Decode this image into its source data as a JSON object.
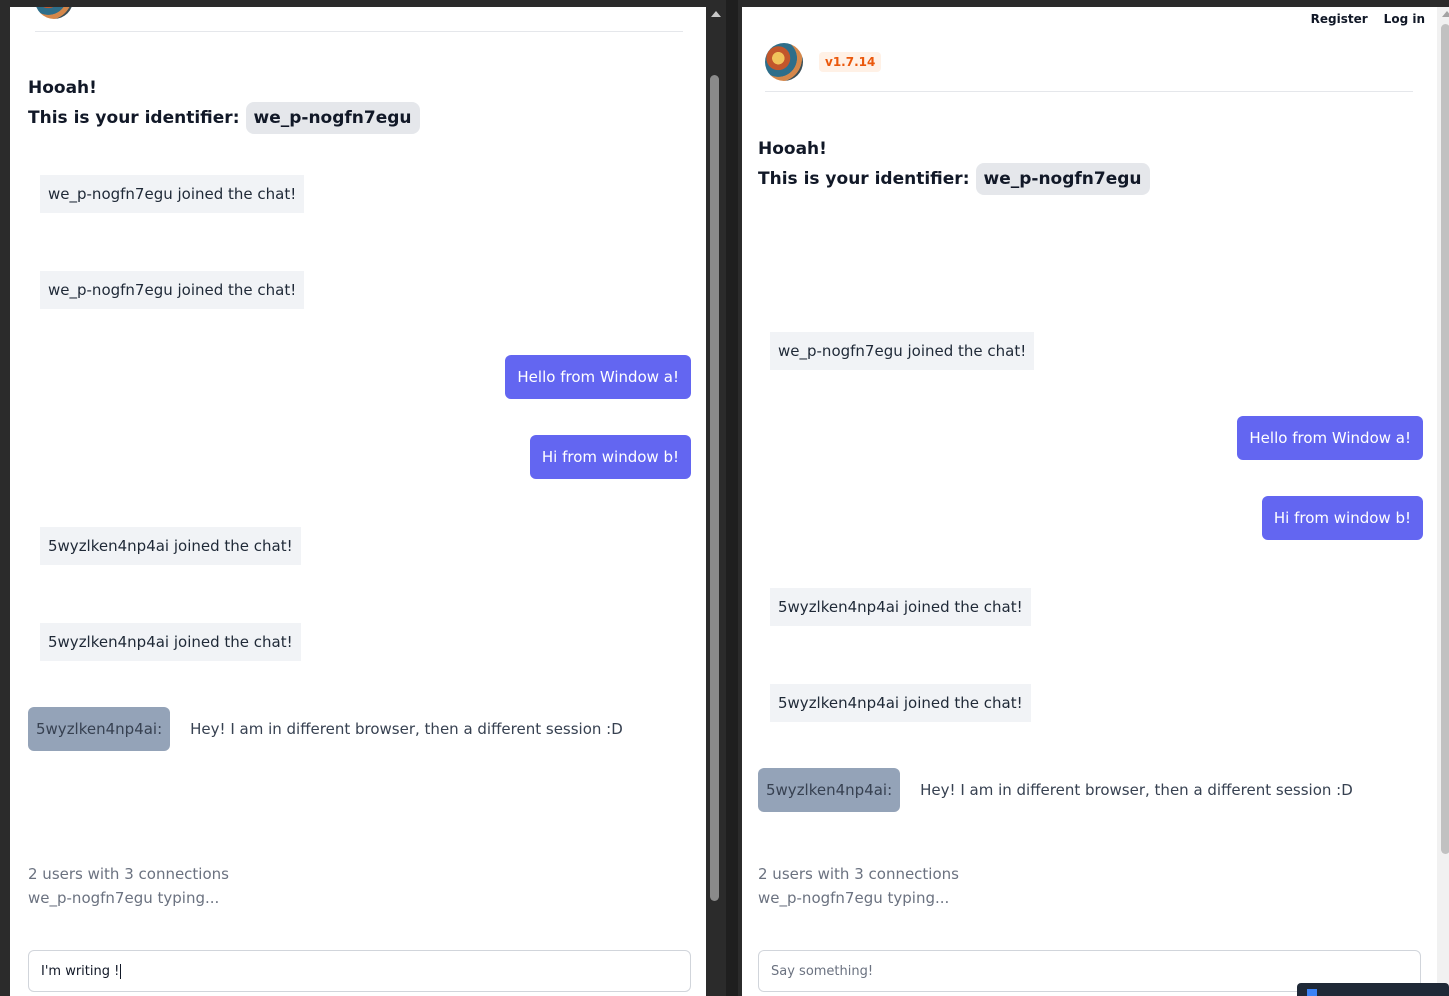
{
  "window_a": {
    "greeting": "Hooah!",
    "identifier_label": "This is your identifier:",
    "identifier": "we_p-nogfn7egu",
    "messages": [
      {
        "kind": "system",
        "text": "we_p-nogfn7egu joined the chat!"
      },
      {
        "kind": "system",
        "text": "we_p-nogfn7egu joined the chat!"
      },
      {
        "kind": "own",
        "text": "Hello from Window a!"
      },
      {
        "kind": "own",
        "text": "Hi from window b!"
      },
      {
        "kind": "system",
        "text": "5wyzlken4np4ai joined the chat!"
      },
      {
        "kind": "system",
        "text": "5wyzlken4np4ai joined the chat!"
      },
      {
        "kind": "user",
        "user": "5wyzlken4np4ai:",
        "text": "Hey! I am in different browser, then a different session :D"
      }
    ],
    "status_connections": "2 users with 3 connections",
    "status_typing": "we_p-nogfn7egu typing...",
    "input_value": "I'm writing !"
  },
  "window_b": {
    "nav": {
      "register": "Register",
      "login": "Log in"
    },
    "version": "v1.7.14",
    "greeting": "Hooah!",
    "identifier_label": "This is your identifier:",
    "identifier": "we_p-nogfn7egu",
    "messages": [
      {
        "kind": "system",
        "text": "we_p-nogfn7egu joined the chat!"
      },
      {
        "kind": "own",
        "text": "Hello from Window a!"
      },
      {
        "kind": "own",
        "text": "Hi from window b!"
      },
      {
        "kind": "system",
        "text": "5wyzlken4np4ai joined the chat!"
      },
      {
        "kind": "system",
        "text": "5wyzlken4np4ai joined the chat!"
      },
      {
        "kind": "user",
        "user": "5wyzlken4np4ai:",
        "text": "Hey! I am in different browser, then a different session :D"
      }
    ],
    "status_connections": "2 users with 3 connections",
    "status_typing": "we_p-nogfn7egu typing...",
    "input_placeholder": "Say something!"
  },
  "colors": {
    "own_message": "#6366f1",
    "system_message": "#f1f3f6",
    "user_tag": "#94a3b8",
    "version_badge": "#ea580c"
  }
}
